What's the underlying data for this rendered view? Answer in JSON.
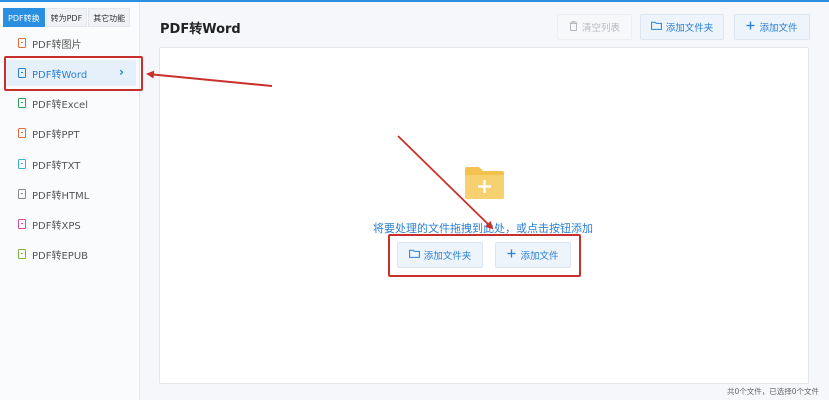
{
  "sidebar": {
    "tabs": [
      {
        "label": "PDF转换",
        "active": true
      },
      {
        "label": "转为PDF",
        "active": false
      },
      {
        "label": "其它功能",
        "active": false
      }
    ],
    "items": [
      {
        "label": "PDF转图片",
        "icon": "image-file-icon",
        "color": "#e0703a"
      },
      {
        "label": "PDF转Word",
        "icon": "word-file-icon",
        "color": "#2a7fd4",
        "active": true
      },
      {
        "label": "PDF转Excel",
        "icon": "excel-file-icon",
        "color": "#2e9e5b"
      },
      {
        "label": "PDF转PPT",
        "icon": "ppt-file-icon",
        "color": "#e0703a"
      },
      {
        "label": "PDF转TXT",
        "icon": "txt-file-icon",
        "color": "#3ab0d8"
      },
      {
        "label": "PDF转HTML",
        "icon": "html-file-icon",
        "color": "#888888"
      },
      {
        "label": "PDF转XPS",
        "icon": "xps-file-icon",
        "color": "#d84a9a"
      },
      {
        "label": "PDF转EPUB",
        "icon": "epub-file-icon",
        "color": "#7cb342"
      }
    ]
  },
  "header": {
    "title": "PDF转Word",
    "clear_label": "清空列表",
    "add_folder_label": "添加文件夹",
    "add_file_label": "添加文件"
  },
  "drop_zone": {
    "hint": "将要处理的文件拖拽到此处，或点击按钮添加",
    "add_folder_label": "添加文件夹",
    "add_file_label": "添加文件"
  },
  "status": {
    "text": "共0个文件，已选择0个文件"
  },
  "colors": {
    "accent": "#2a7fd4",
    "annotation": "#c9302c"
  }
}
